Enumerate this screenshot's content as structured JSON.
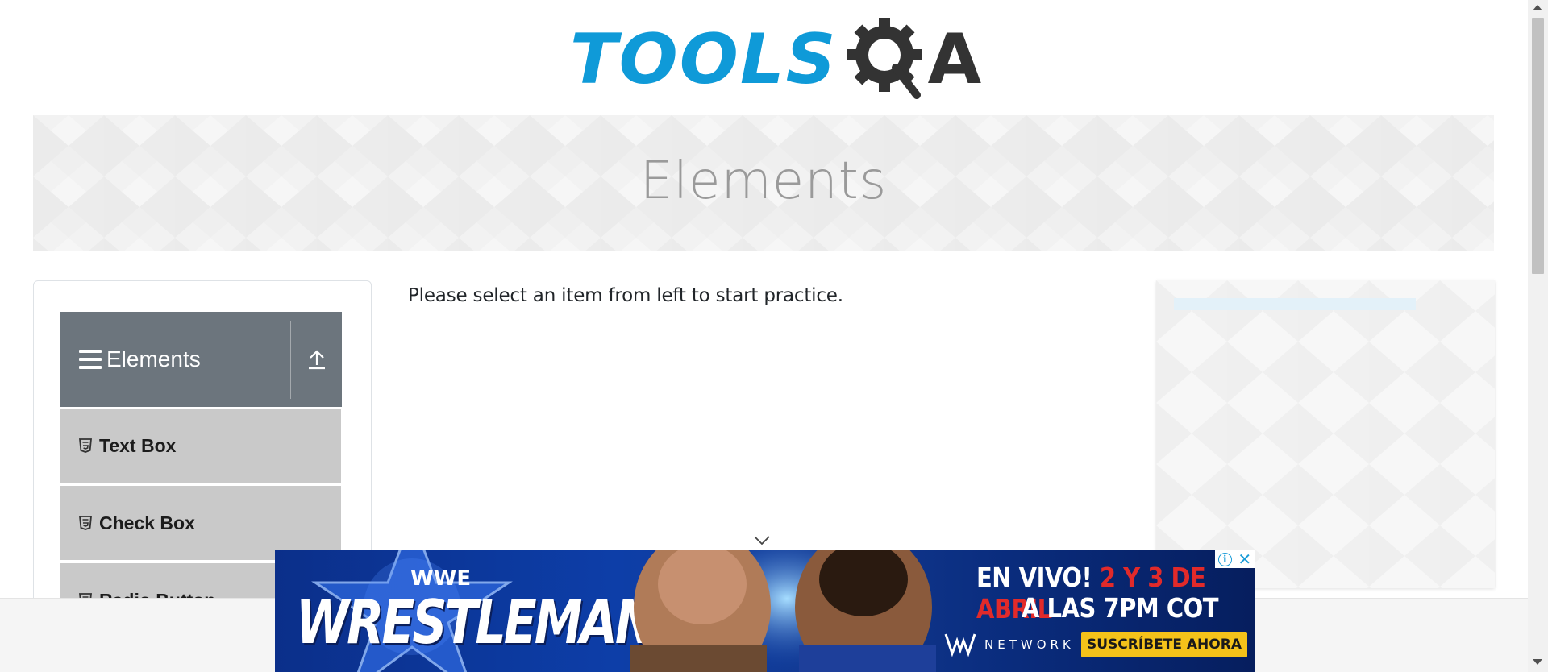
{
  "logo": {
    "text_tools": "TOOLS",
    "text_q": "Q",
    "text_a": "A",
    "brand_color": "#0f9ad8",
    "dark_color": "#333333"
  },
  "banner": {
    "title": "Elements"
  },
  "sidebar": {
    "group": {
      "title": "Elements",
      "icon": "hamburger-icon",
      "toggle_icon": "collapse-up-icon"
    },
    "items": [
      {
        "label": "Text Box",
        "icon": "html5-icon"
      },
      {
        "label": "Check Box",
        "icon": "html5-icon"
      },
      {
        "label": "Radio Button",
        "icon": "html5-icon"
      }
    ]
  },
  "main": {
    "instruction": "Please select an item from left to start practice."
  },
  "bottom_ad": {
    "brand": "WWE",
    "headline": "WRESTLEMANIA",
    "line1_white": "EN VIVO!",
    "line1_red": "2 Y 3 DE ABRIL",
    "line2": "A LAS 7PM COT",
    "network": "NETWORK",
    "cta": "SUSCRÍBETE AHORA",
    "choices_info": "i",
    "choices_close": "✕"
  },
  "colors": {
    "sidebar_header": "#6c757d",
    "menu_item_bg": "#c9c9c9",
    "cta_bg": "#f4c21a",
    "ad_red": "#e22a2a"
  }
}
